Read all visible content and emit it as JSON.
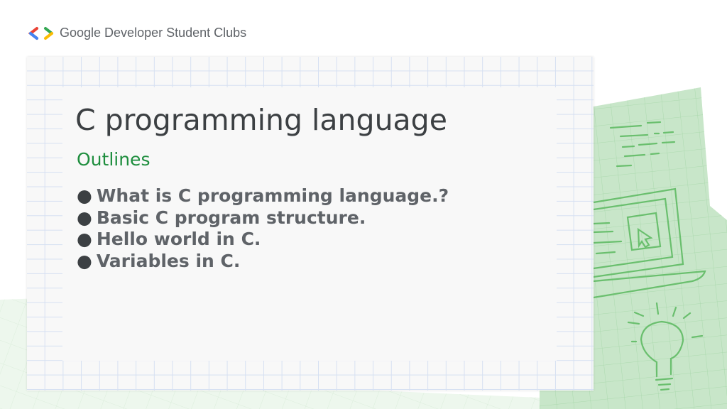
{
  "brand": {
    "logo_text": "Google Developer Student Clubs"
  },
  "slide": {
    "title": "C programming language",
    "subtitle": "Outlines",
    "bullet_glyph": "●",
    "bullets": [
      "What is C programming language.?",
      "Basic C program structure.",
      "Hello world in C.",
      "Variables in C."
    ]
  },
  "colors": {
    "accent_green": "#1e8e3e",
    "title": "#3c4043",
    "body": "#5f6368",
    "sketch_green": "#c8e6c9"
  }
}
